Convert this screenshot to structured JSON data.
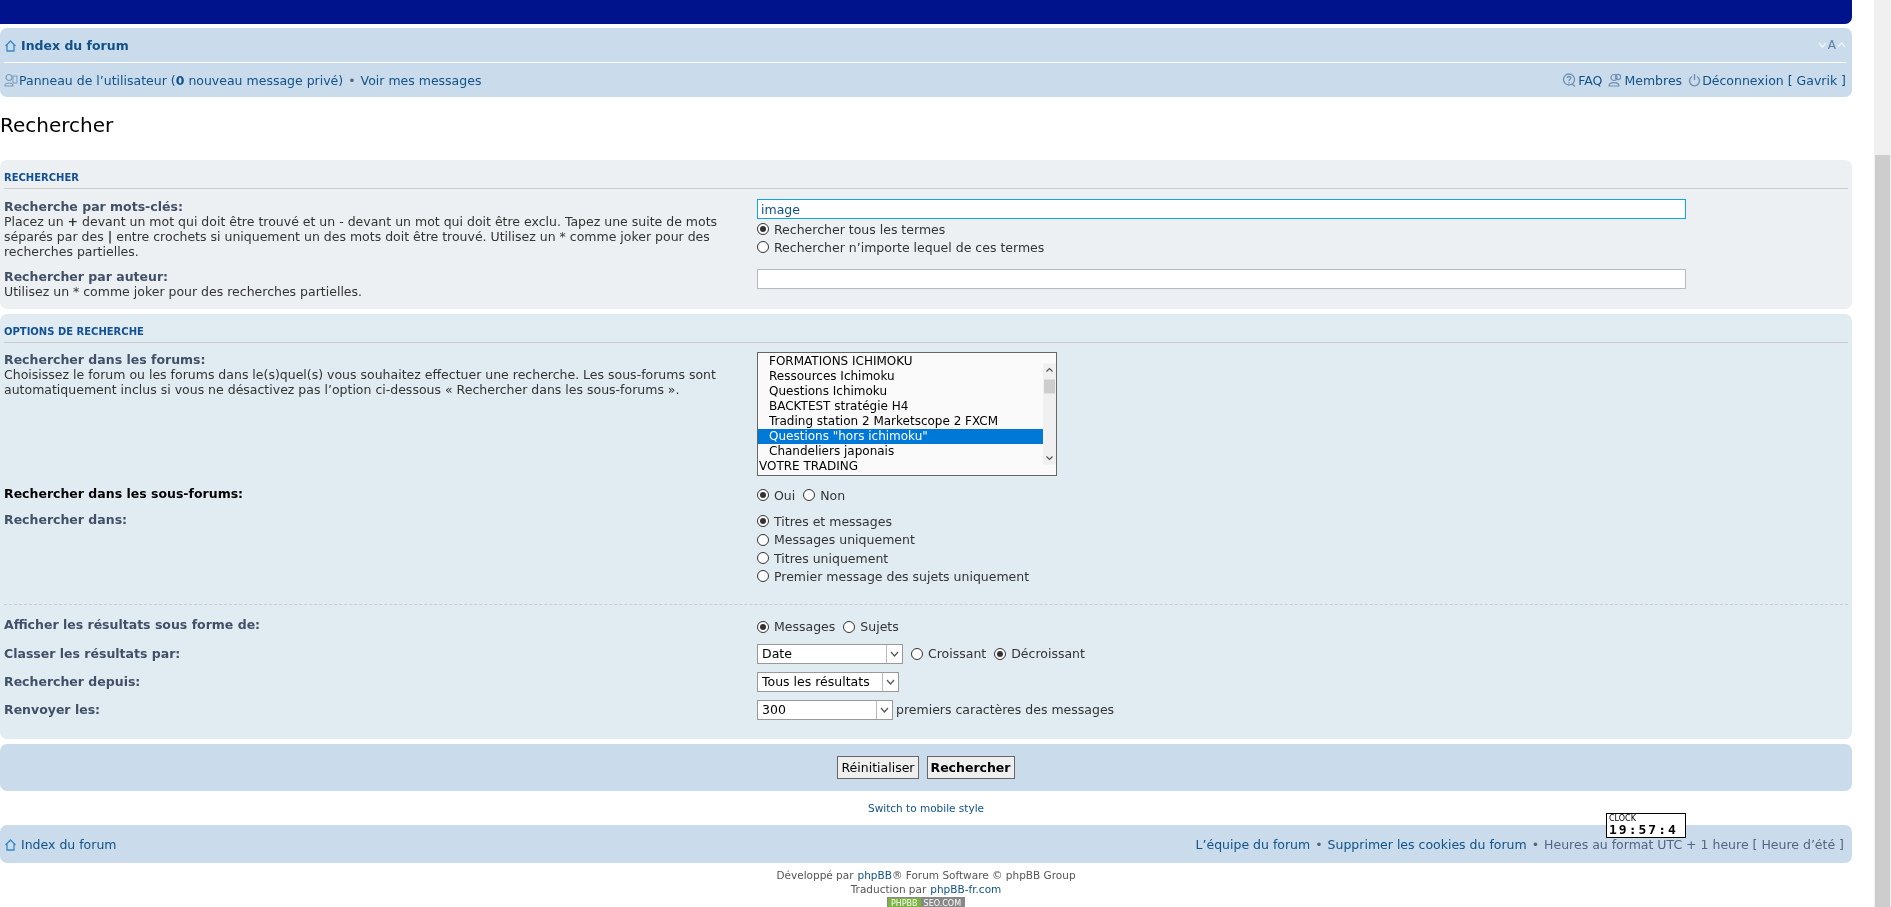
{
  "navbar": {
    "breadcrumb": "Index du forum",
    "font_size_label": "A",
    "user_links": [
      {
        "kind": "user",
        "label": "Panneau de l’utilisateur (**0** nouveau message privé)"
      },
      {
        "kind": "plain",
        "label": "Voir mes messages"
      }
    ],
    "separator": "•",
    "right_links": [
      {
        "kind": "faq",
        "label": "FAQ"
      },
      {
        "kind": "members",
        "label": "Membres"
      },
      {
        "kind": "logout",
        "label": "Déconnexion [ Gavrik ]"
      }
    ]
  },
  "page_title": "Rechercher",
  "search_panel": {
    "title": "RECHERCHER",
    "keywords": {
      "label": "Recherche par mots-clés:",
      "help": "Placez un **+** devant un mot qui doit être trouvé et un - devant un mot qui doit être exclu. Tapez une suite de mots séparés par des **|** entre crochets si uniquement un des mots doit être trouvé. Utilisez un * comme joker pour des recherches partielles.",
      "value": "image",
      "focused": true
    },
    "match_options": [
      {
        "label": "Rechercher tous les termes",
        "selected": true
      },
      {
        "label": "Rechercher n’importe lequel de ces termes",
        "selected": false
      }
    ],
    "author": {
      "label": "Rechercher par auteur:",
      "help": "Utilisez un * comme joker pour des recherches partielles.",
      "focused": false
    }
  },
  "options_panel": {
    "title": "OPTIONS DE RECHERCHE",
    "forums": {
      "label": "Rechercher dans les forums:",
      "help": "Choisissez le forum ou les forums dans le(s)quel(s) vous souhaitez effectuer une recherche. Les sous-forums sont automatiquement inclus si vous ne désactivez pas l’option ci-dessous « Rechercher dans les sous-forums ».",
      "items": [
        {
          "kind": "subforum",
          "label": "FORMATIONS ICHIMOKU",
          "selected": false
        },
        {
          "kind": "subforum",
          "label": "Ressources Ichimoku",
          "selected": false
        },
        {
          "kind": "subforum",
          "label": "Questions Ichimoku",
          "selected": false
        },
        {
          "kind": "subforum",
          "label": "BACKTEST stratégie H4",
          "selected": false
        },
        {
          "kind": "subforum",
          "label": "Trading station 2 Marketscope 2 FXCM",
          "selected": false
        },
        {
          "kind": "subforum",
          "label": "Questions \"hors ichimoku\"",
          "selected": true
        },
        {
          "kind": "subforum",
          "label": "Chandeliers japonais",
          "selected": false
        },
        {
          "kind": "category",
          "label": "VOTRE TRADING",
          "selected": false
        }
      ]
    },
    "subforums": {
      "label": "Rechercher dans les sous-forums:",
      "highlighted": true,
      "options": [
        {
          "label": "Oui",
          "selected": true
        },
        {
          "label": "Non",
          "selected": false
        }
      ]
    },
    "search_in": {
      "label": "Rechercher dans:",
      "highlighted": false,
      "options": [
        {
          "label": "Titres et messages",
          "selected": true
        },
        {
          "label": "Messages uniquement",
          "selected": false
        },
        {
          "label": "Titres uniquement",
          "selected": false
        },
        {
          "label": "Premier message des sujets uniquement",
          "selected": false
        }
      ]
    },
    "display": {
      "label": "Afficher les résultats sous forme de:",
      "highlighted": false,
      "options": [
        {
          "label": "Messages",
          "selected": true
        },
        {
          "label": "Sujets",
          "selected": false
        }
      ]
    },
    "sort": {
      "label": "Classer les résultats par:",
      "highlighted": false,
      "select": "Date",
      "options": [
        {
          "label": "Croissant",
          "selected": false
        },
        {
          "label": "Décroissant",
          "selected": true
        }
      ]
    },
    "since": {
      "label": "Rechercher depuis:",
      "highlighted": false,
      "select": "Tous les résultats"
    },
    "return": {
      "label": "Renvoyer les:",
      "highlighted": false,
      "select": "300",
      "suffix": "premiers caractères des messages"
    }
  },
  "buttons": [
    {
      "label": "Réinitialiser",
      "primary": false
    },
    {
      "label": "Rechercher",
      "primary": true
    }
  ],
  "mobile_link": "Switch to mobile style",
  "footer": {
    "breadcrumb": "Index du forum",
    "links": [
      "L’équipe du forum",
      "Supprimer les cookies du forum"
    ],
    "separator": "•",
    "timezone": "Heures au format UTC + 1 heure [ Heure d’été ]"
  },
  "clock": {
    "label": "CLOCK",
    "time": "19:57:4"
  },
  "credits": {
    "line1": {
      "before": "Développé par",
      "link": "phpBB",
      "after": "® Forum Software © phpBB Group"
    },
    "line2": {
      "before": "Traduction par",
      "link": "phpBB-fr.com"
    },
    "badge": [
      "PHPBB",
      "SEO.COM"
    ]
  }
}
